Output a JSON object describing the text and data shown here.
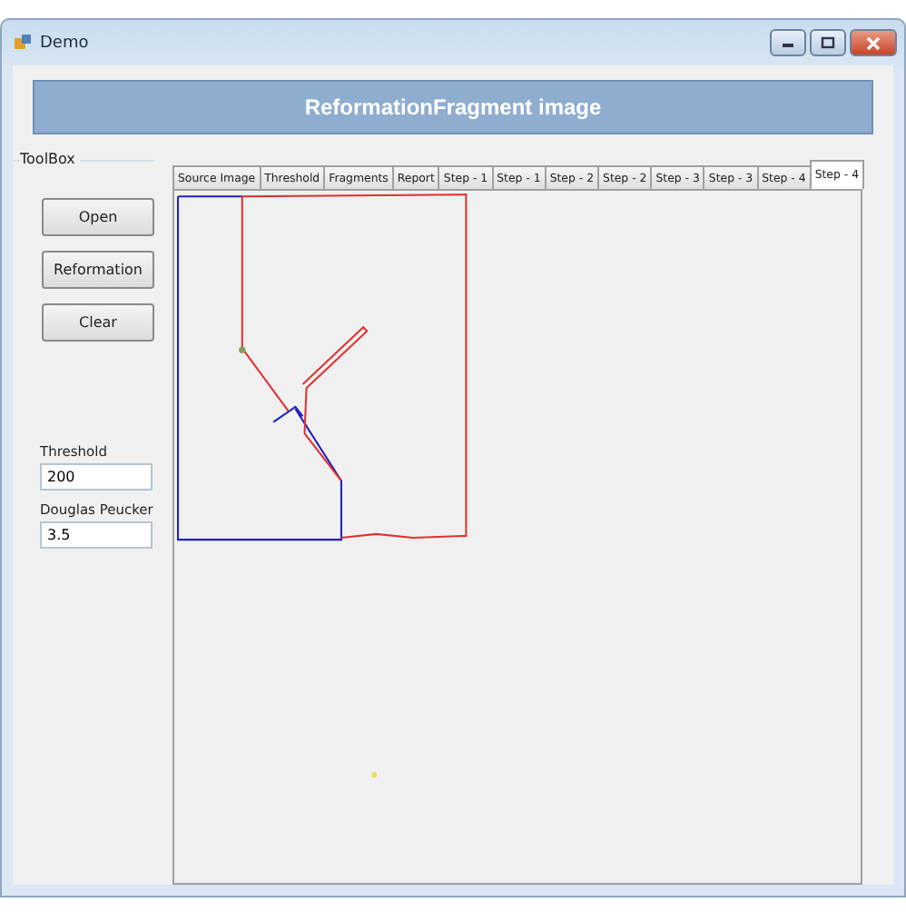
{
  "window": {
    "title": "Demo"
  },
  "header": {
    "title": "ReformationFragment image"
  },
  "toolbox": {
    "title": "ToolBox",
    "buttons": [
      "Open",
      "Reformation",
      "Clear"
    ],
    "fields": [
      {
        "label": "Threshold",
        "value": "200"
      },
      {
        "label": "Douglas Peucker",
        "value": "3.5"
      }
    ]
  },
  "tabs": [
    {
      "label": "Source Image",
      "selected": false
    },
    {
      "label": "Threshold",
      "selected": false
    },
    {
      "label": "Fragments",
      "selected": false
    },
    {
      "label": "Report",
      "selected": false
    },
    {
      "label": "Step - 1",
      "selected": false
    },
    {
      "label": "Step - 1",
      "selected": false
    },
    {
      "label": "Step - 2",
      "selected": false
    },
    {
      "label": "Step - 2",
      "selected": false
    },
    {
      "label": "Step - 3",
      "selected": false
    },
    {
      "label": "Step - 3",
      "selected": false
    },
    {
      "label": "Step - 4",
      "selected": false
    },
    {
      "label": "Step - 4",
      "selected": true
    }
  ]
}
